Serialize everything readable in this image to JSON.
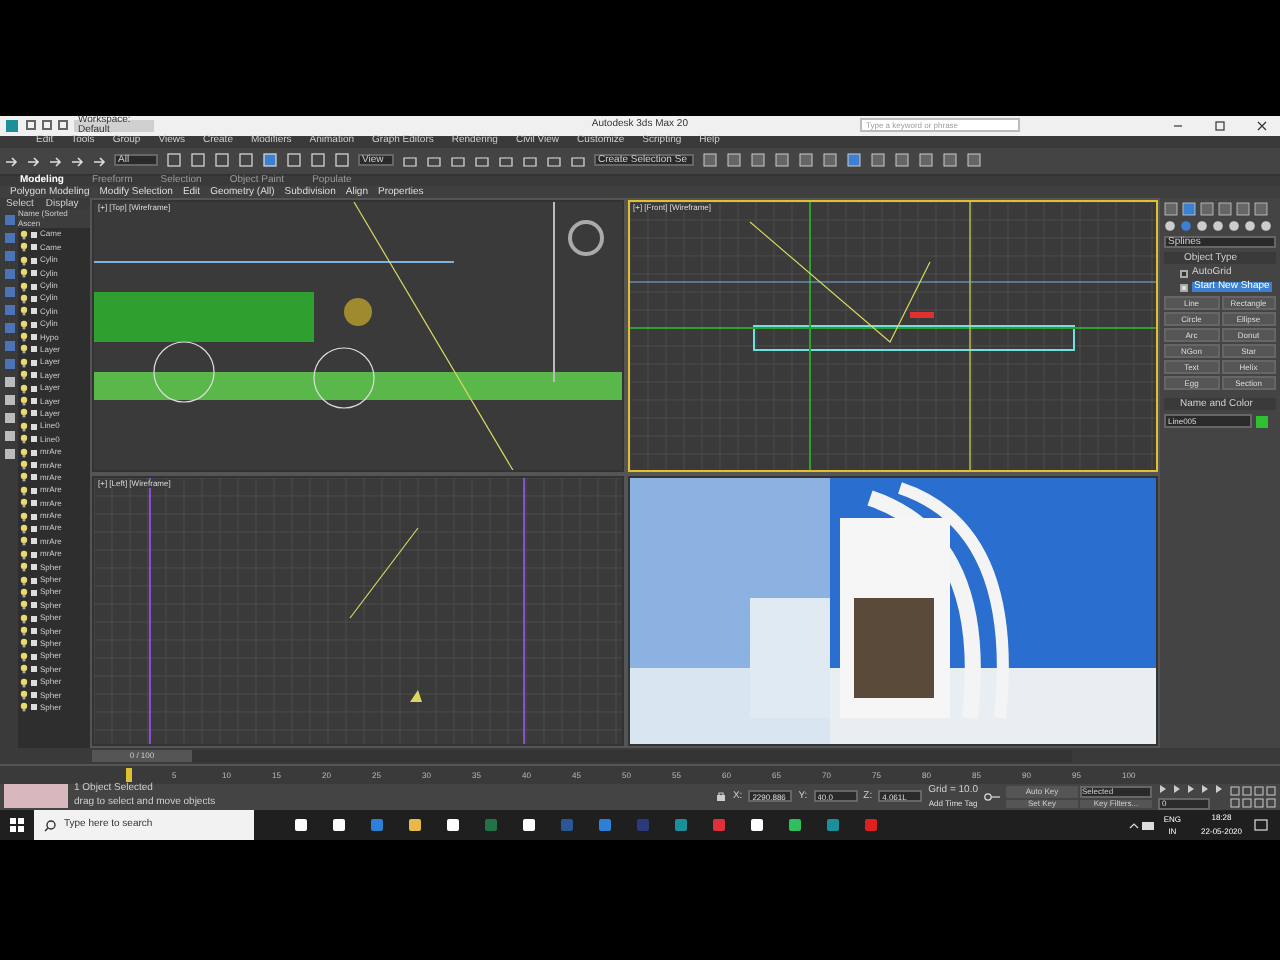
{
  "title_bar": {
    "workspace": "Workspace: Default",
    "title": "Autodesk 3ds Max 20",
    "search_placeholder": "Type a keyword or phrase"
  },
  "menu": [
    "Edit",
    "Tools",
    "Group",
    "Views",
    "Create",
    "Modifiers",
    "Animation",
    "Graph Editors",
    "Rendering",
    "Civil View",
    "Customize",
    "Scripting",
    "Help"
  ],
  "toolbar": {
    "selection_filter": "All",
    "reference": "View",
    "named_selection": "Create Selection Se"
  },
  "ribbon_tabs": [
    {
      "label": "Modeling",
      "selected": true
    },
    {
      "label": "Freeform",
      "selected": false
    },
    {
      "label": "Selection",
      "selected": false
    },
    {
      "label": "Object Paint",
      "selected": false
    },
    {
      "label": "Populate",
      "selected": false
    }
  ],
  "ribbon_panels": [
    "Polygon Modeling",
    "Modify Selection",
    "Edit",
    "Geometry (All)",
    "Subdivision",
    "Align",
    "Properties"
  ],
  "explorer": {
    "tabs": [
      "Select",
      "Display"
    ],
    "column": "Name (Sorted Ascen",
    "items": [
      "Came",
      "Came",
      "Cylin",
      "Cylin",
      "Cylin",
      "Cylin",
      "Cylin",
      "Cylin",
      "Hypo",
      "Layer",
      "Layer",
      "Layer",
      "Layer",
      "Layer",
      "Layer",
      "Line0",
      "Line0",
      "mrAre",
      "mrAre",
      "mrAre",
      "mrAre",
      "mrAre",
      "mrAre",
      "mrAre",
      "mrAre",
      "mrAre",
      "Spher",
      "Spher",
      "Spher",
      "Spher",
      "Spher",
      "Spher",
      "Spher",
      "Spher",
      "Spher",
      "Spher",
      "Spher",
      "Spher"
    ]
  },
  "viewports": [
    {
      "label": "[+] [Top] [Wireframe]",
      "kind": "top",
      "active": false
    },
    {
      "label": "[+] [Front] [Wireframe]",
      "kind": "front",
      "active": true
    },
    {
      "label": "[+] [Left] [Wireframe]",
      "kind": "left",
      "active": false
    },
    {
      "kind": "perspective",
      "active": false
    }
  ],
  "command_panel": {
    "dropdown": "Splines",
    "object_type_title": "Object Type",
    "options": [
      {
        "label": "AutoGrid",
        "checked": false
      },
      {
        "label": "Start New Shape",
        "checked": true
      }
    ],
    "buttons": [
      "Line",
      "Rectangle",
      "Circle",
      "Ellipse",
      "Arc",
      "Donut",
      "NGon",
      "Star",
      "Text",
      "Helix",
      "Egg",
      "Section"
    ],
    "name_color_title": "Name and Color",
    "name": "Line005"
  },
  "timeline": {
    "frame": "0 / 100",
    "ticks": [
      "5",
      "10",
      "15",
      "20",
      "25",
      "30",
      "35",
      "40",
      "45",
      "50",
      "55",
      "60",
      "65",
      "70",
      "75",
      "80",
      "85",
      "90",
      "95",
      "100"
    ]
  },
  "status": {
    "selected": "1 Object Selected",
    "prompt": "drag to select and move objects",
    "coordinates": [
      {
        "axis": "X:",
        "value": "2290.886"
      },
      {
        "axis": "Y:",
        "value": "40.0"
      },
      {
        "axis": "Z:",
        "value": "4.061L"
      }
    ],
    "grid": "Grid = 10.0",
    "time_tag": "Add Time Tag",
    "auto_key": "Auto Key",
    "key_mode": "Selected",
    "set_key": "Set Key",
    "key_filters": "Key Filters...",
    "frame": "0"
  },
  "taskbar": {
    "search_placeholder": "Type here to search",
    "lang": "ENG",
    "region": "IN",
    "time": "18:28",
    "date": "22-05-2020"
  }
}
